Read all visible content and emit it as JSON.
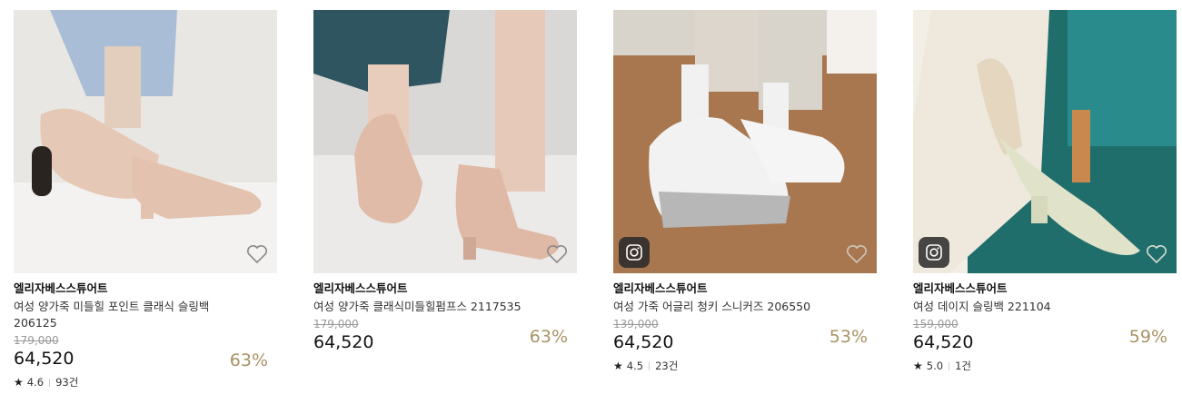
{
  "products": [
    {
      "brand": "엘리자베스스튜어트",
      "title": "여성 양가죽 미들힐 포인트 클래식 슬링백 206125",
      "original_price": "179,000",
      "price": "64,520",
      "discount": "63%",
      "rating": "4.6",
      "reviews": "93건",
      "has_instagram": false
    },
    {
      "brand": "엘리자베스스튜어트",
      "title": "여성 양가죽 클래식미들힐펌프스 2117535",
      "original_price": "179,000",
      "price": "64,520",
      "discount": "63%",
      "rating": null,
      "reviews": null,
      "has_instagram": false
    },
    {
      "brand": "엘리자베스스튜어트",
      "title": "여성 가죽 어글리 청키 스니커즈 206550",
      "original_price": "139,000",
      "price": "64,520",
      "discount": "53%",
      "rating": "4.5",
      "reviews": "23건",
      "has_instagram": true
    },
    {
      "brand": "엘리자베스스튜어트",
      "title": "여성 데이지 슬링백 221104",
      "original_price": "159,000",
      "price": "64,520",
      "discount": "59%",
      "rating": "5.0",
      "reviews": "1건",
      "has_instagram": true
    }
  ],
  "icons": {
    "wishlist": "heart-outline-icon",
    "instagram": "instagram-icon",
    "star": "star-icon"
  },
  "colors": {
    "discount": "#a89366",
    "original_price": "#999999"
  }
}
